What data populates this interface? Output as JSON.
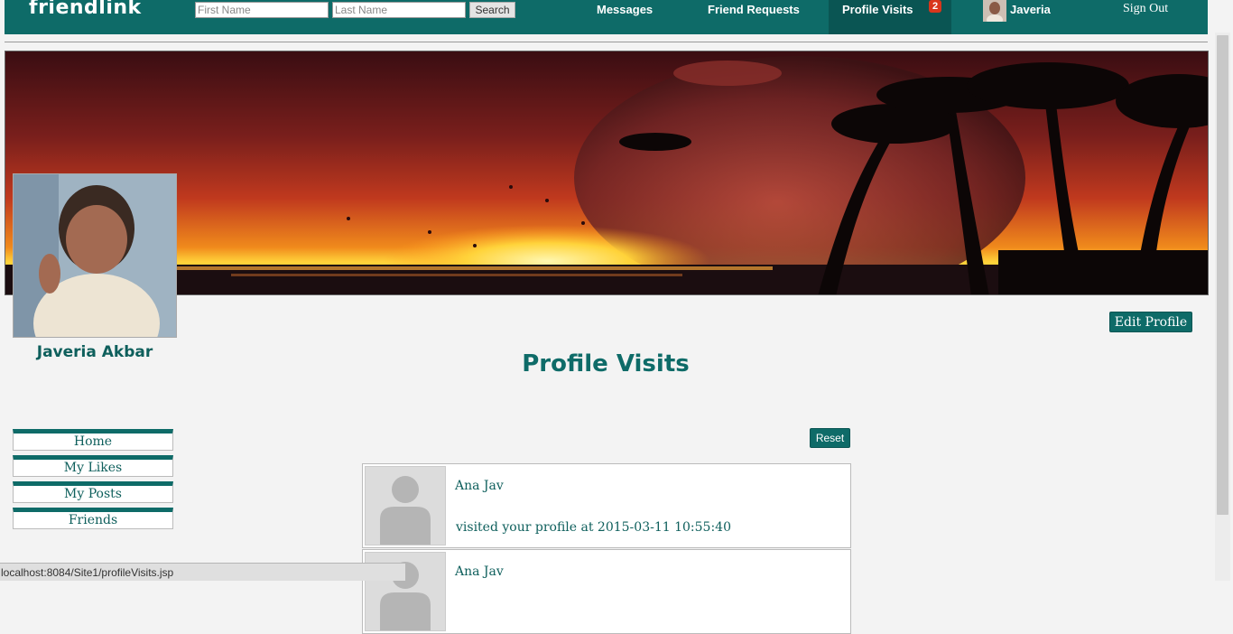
{
  "navbar": {
    "brand": "friendlink",
    "first_name_placeholder": "First Name",
    "last_name_placeholder": "Last Name",
    "search_label": "Search",
    "links": {
      "messages": "Messages",
      "friend_requests": "Friend Requests",
      "profile_visits": "Profile Visits",
      "profile_visits_badge": "2",
      "user": "Javeria",
      "sign_out": "Sign Out"
    },
    "colors": {
      "bar": "#0e6b68",
      "active": "#0a5553",
      "badge": "#d9361c"
    }
  },
  "profile": {
    "name": "Javeria Akbar",
    "edit_label": "Edit Profile"
  },
  "page": {
    "title": "Profile Visits",
    "reset_label": "Reset"
  },
  "sidebar": {
    "items": [
      {
        "label": "Home"
      },
      {
        "label": "My Likes"
      },
      {
        "label": "My Posts"
      },
      {
        "label": "Friends"
      }
    ]
  },
  "visits": [
    {
      "name": "Ana Jav",
      "text": "visited your profile at 2015-03-11 10:55:40"
    },
    {
      "name": "Ana Jav",
      "text": ""
    }
  ],
  "status_bar": {
    "url": "localhost:8084/Site1/profileVisits.jsp"
  }
}
